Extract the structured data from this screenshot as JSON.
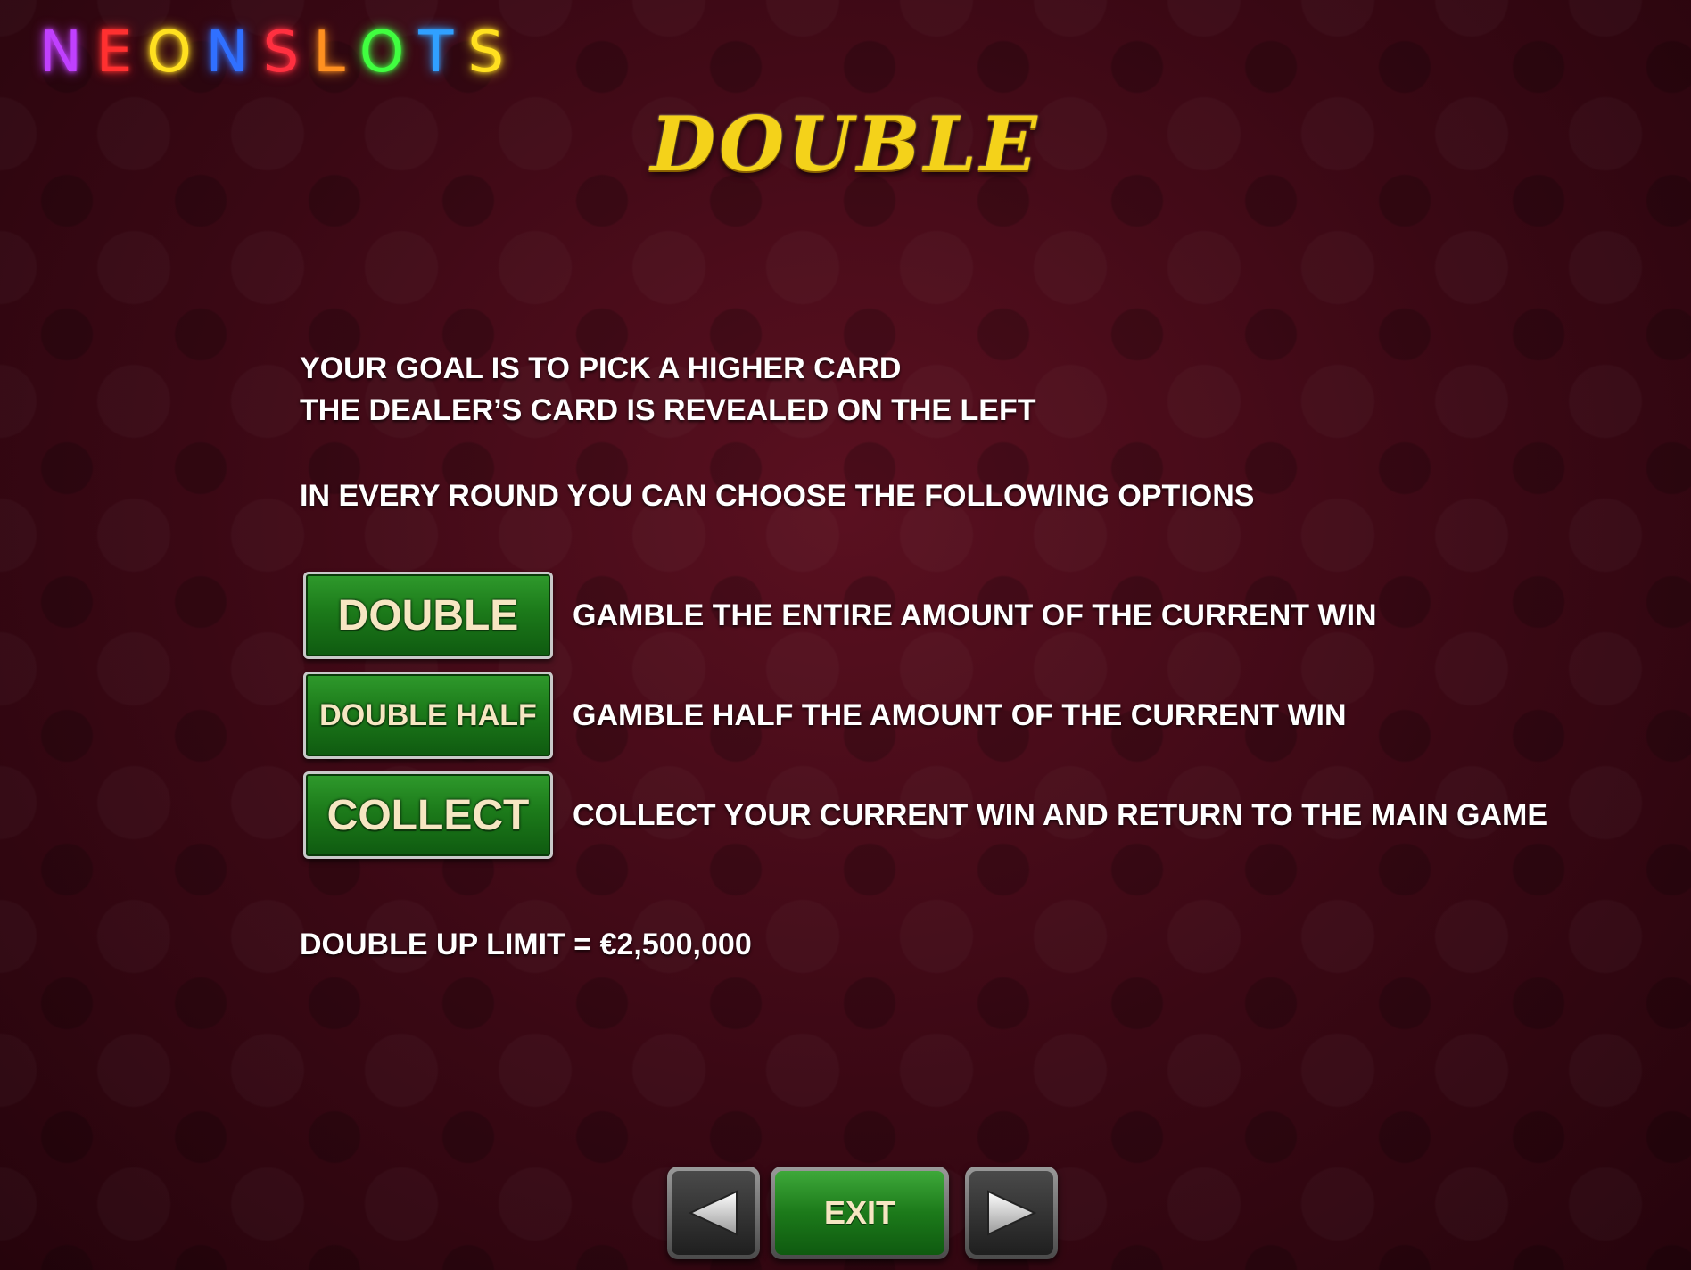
{
  "logo": {
    "letters": [
      {
        "char": "N",
        "color": "#c040ff"
      },
      {
        "char": "E",
        "color": "#ff3030"
      },
      {
        "char": "O",
        "color": "#ffe020"
      },
      {
        "char": "N",
        "color": "#3070ff"
      },
      {
        "char": "S",
        "color": "#ff3040"
      },
      {
        "char": "L",
        "color": "#ff9020"
      },
      {
        "char": "O",
        "color": "#40ff40"
      },
      {
        "char": "T",
        "color": "#30a0ff"
      },
      {
        "char": "S",
        "color": "#ffe020"
      }
    ]
  },
  "title": "DOUBLE",
  "intro": {
    "line1": "YOUR GOAL IS TO PICK A HIGHER CARD",
    "line2": "THE DEALER’S CARD IS REVEALED ON THE LEFT",
    "line3": "IN EVERY ROUND YOU CAN CHOOSE THE FOLLOWING OPTIONS"
  },
  "options": [
    {
      "button": "DOUBLE",
      "description": "GAMBLE THE ENTIRE AMOUNT OF THE CURRENT WIN"
    },
    {
      "button": "DOUBLE HALF",
      "description": "GAMBLE HALF THE AMOUNT OF THE CURRENT WIN"
    },
    {
      "button": "COLLECT",
      "description": "COLLECT YOUR CURRENT WIN AND RETURN TO THE MAIN GAME"
    }
  ],
  "limit": "DOUBLE UP LIMIT = €2,500,000",
  "nav": {
    "prev_icon": "left-arrow-icon",
    "exit_label": "EXIT",
    "next_icon": "right-arrow-icon"
  },
  "colors": {
    "background": "#3a0814",
    "title": "#f4d21a",
    "button_green": "#1c7a1a"
  }
}
